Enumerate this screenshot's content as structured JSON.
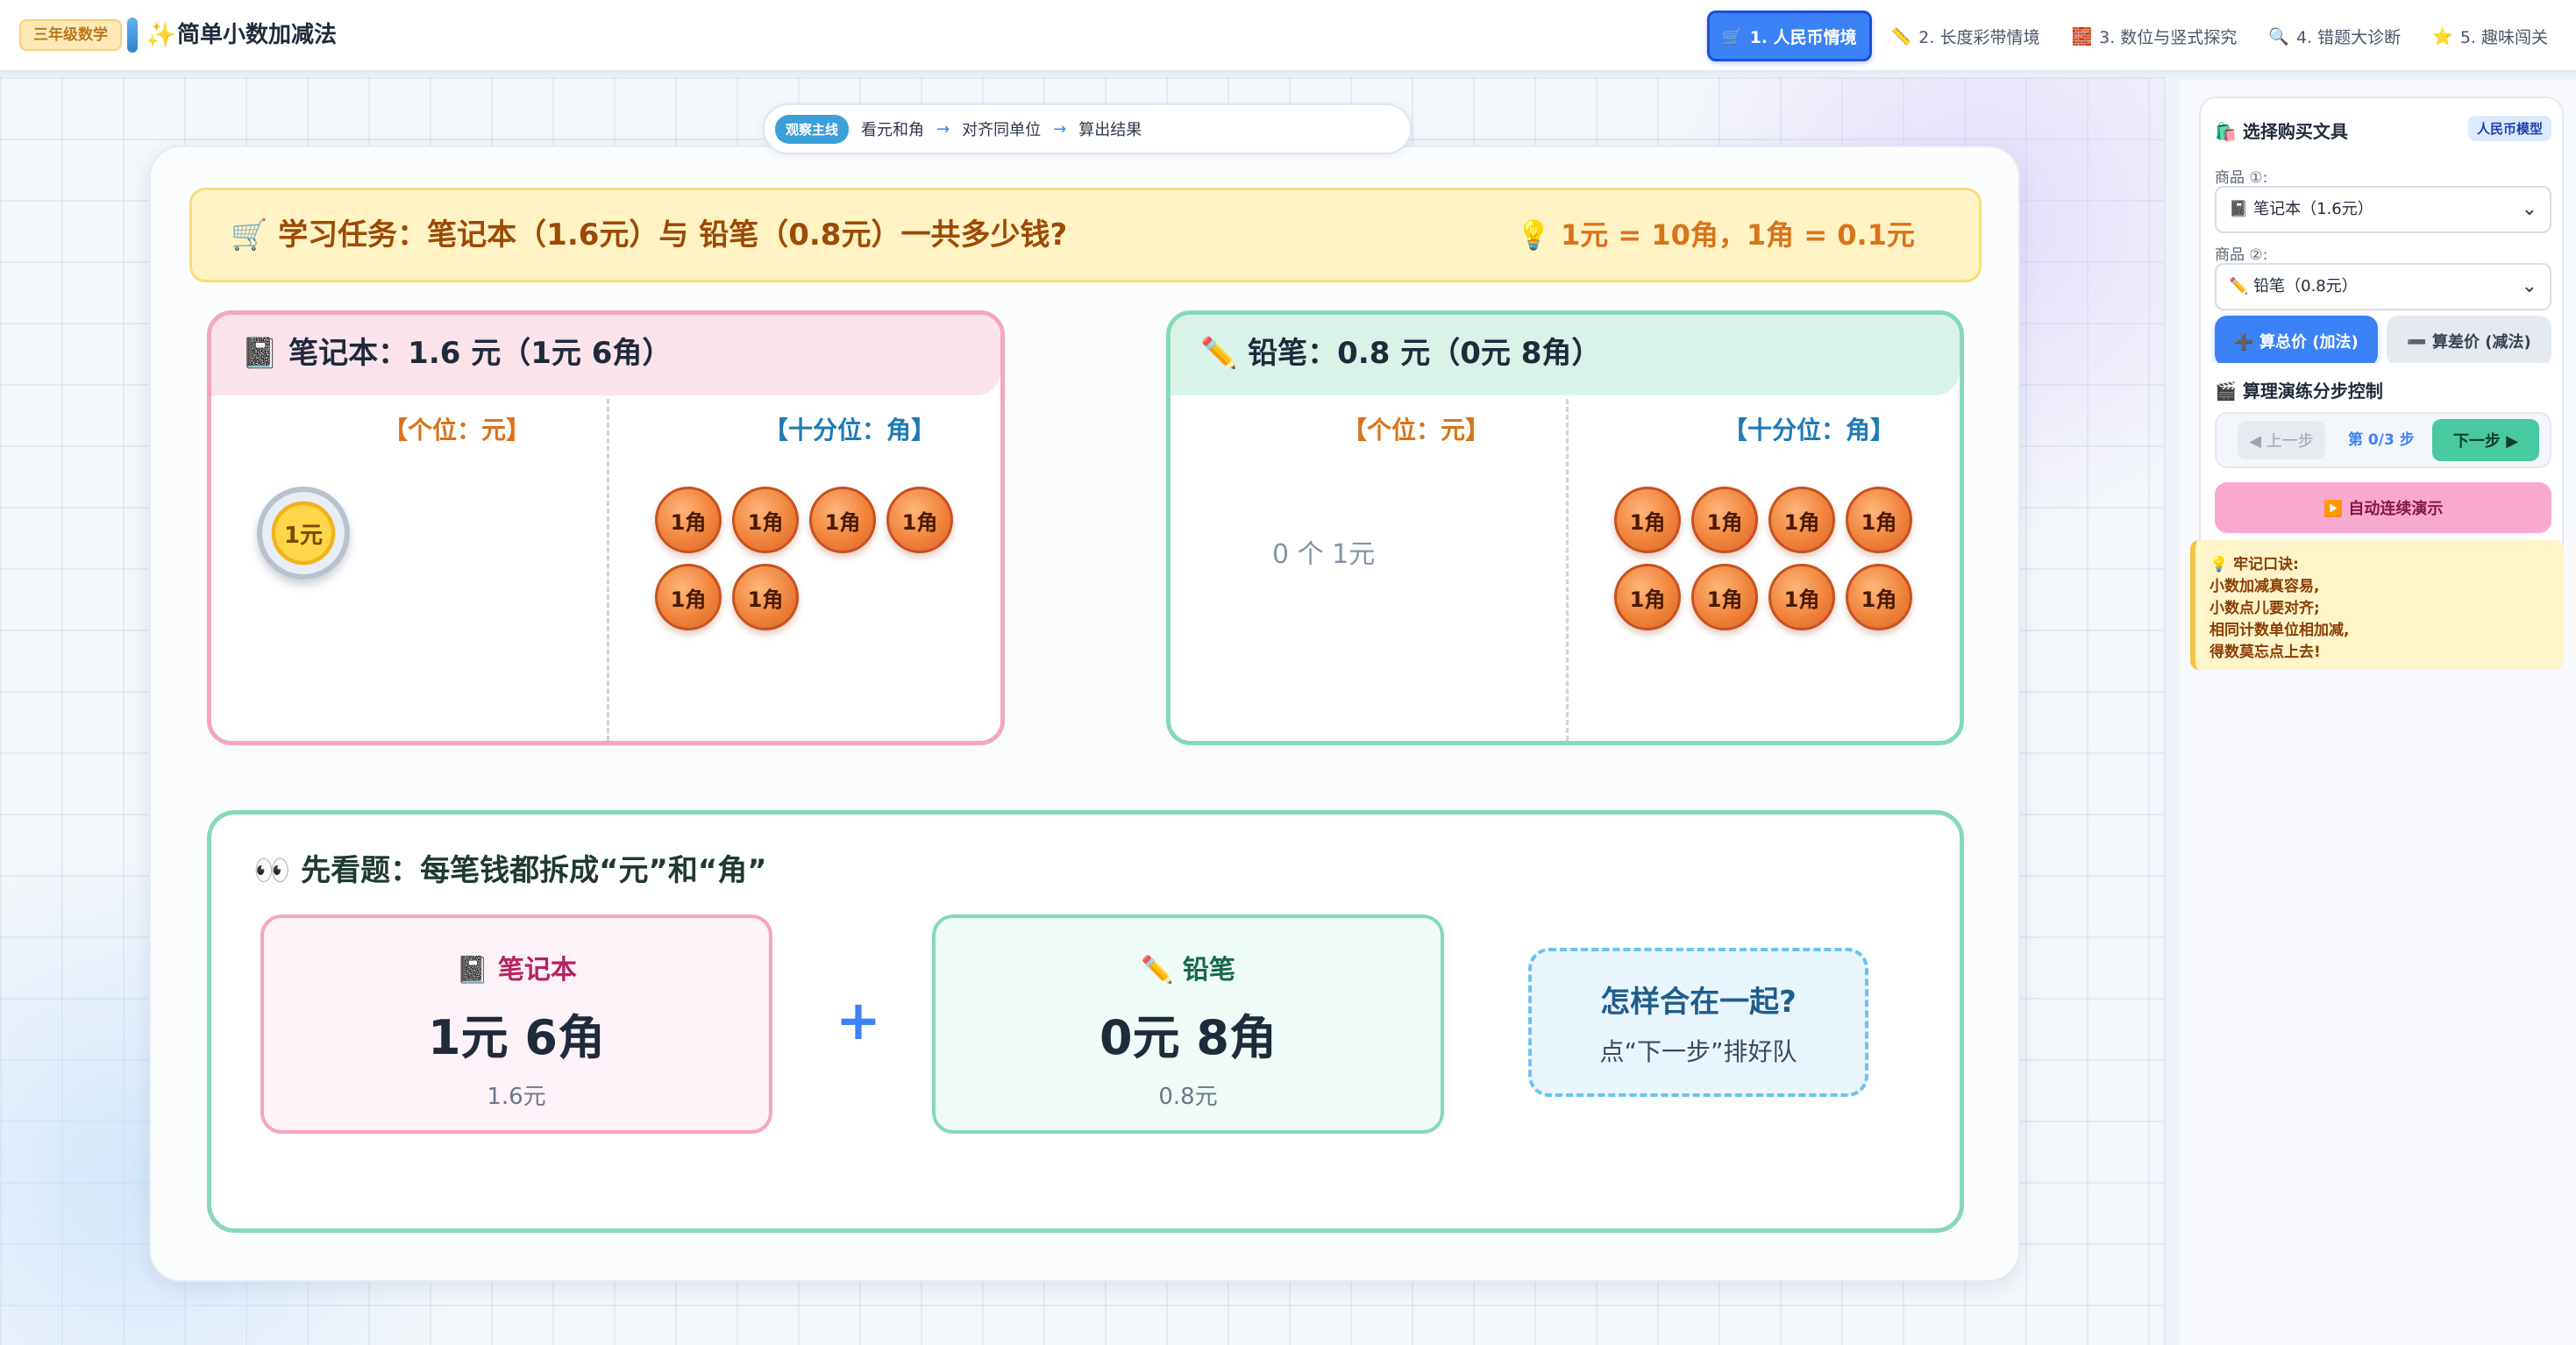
{
  "header": {
    "grade_badge": "三年级数学",
    "sparkle_icon": "✨",
    "app_title": "简单小数加减法",
    "tabs": [
      {
        "icon": "🛒",
        "label": "1. 人民币情境",
        "active": true
      },
      {
        "icon": "📏",
        "label": "2. 长度彩带情境",
        "active": false
      },
      {
        "icon": "🧱",
        "label": "3. 数位与竖式探究",
        "active": false
      },
      {
        "icon": "🔍",
        "label": "4. 错题大诊断",
        "active": false
      },
      {
        "icon": "⭐",
        "label": "5. 趣味闯关",
        "active": false
      }
    ]
  },
  "observe": {
    "tag": "观察主线",
    "steps": [
      "看元和角",
      "对齐同单位",
      "算出结果"
    ],
    "arrow": "→"
  },
  "task": {
    "text": "🛒 学习任务：笔记本（1.6元）与 铅笔（0.8元）一共多少钱?",
    "hint": "💡 1元 = 10角，1角 = 0.1元"
  },
  "items": [
    {
      "title": "📓 笔记本：1.6 元（1元 6角）",
      "yuan_label": "【个位：元】",
      "jiao_label": "【十分位：角】",
      "yuan_coin": "1元",
      "yuan_count": 1,
      "jiao_coin": "1角",
      "jiao_count": 6,
      "zero_text": ""
    },
    {
      "title": "✏️ 铅笔：0.8 元（0元 8角）",
      "yuan_label": "【个位：元】",
      "jiao_label": "【十分位：角】",
      "yuan_coin": "1元",
      "yuan_count": 0,
      "jiao_coin": "1角",
      "jiao_count": 8,
      "zero_text": "0 个 1元"
    }
  ],
  "preview": {
    "title": "👀 先看题：每笔钱都拆成“元”和“角”",
    "left": {
      "label": "📓 笔记本",
      "amount": "1元 6角",
      "decimal": "1.6元"
    },
    "plus": "+",
    "right": {
      "label": "✏️ 铅笔",
      "amount": "0元 8角",
      "decimal": "0.8元"
    },
    "question_main": "怎样合在一起?",
    "question_sub": "点“下一步”排好队"
  },
  "sidebar": {
    "select_title": "🛍️ 选择购买文具",
    "model_badge": "人民币模型",
    "item1_label": "商品 ①:",
    "item1_value": "📓 笔记本（1.6元）",
    "item2_label": "商品 ②:",
    "item2_value": "✏️ 铅笔（0.8元）",
    "add_button": "➕ 算总价 (加法)",
    "sub_button": "➖ 算差价 (减法)",
    "step_title": "🎬 算理演练分步控制",
    "prev_button": "◀ 上一步",
    "step_counter": "第 0/3 步",
    "next_button": "下一步 ▶",
    "auto_button": "▶️ 自动连续演示",
    "mnemonic": [
      "💡 牢记口诀:",
      "小数加减真容易,",
      "小数点儿要对齐;",
      "相同计数单位相加减,",
      "得数莫忘点上去!"
    ]
  },
  "colors": {
    "accent_blue": "#3b82f6",
    "pink_border": "#f4a5c4",
    "green_border": "#86d9b6",
    "banner_yellow": "#fff3c4"
  }
}
